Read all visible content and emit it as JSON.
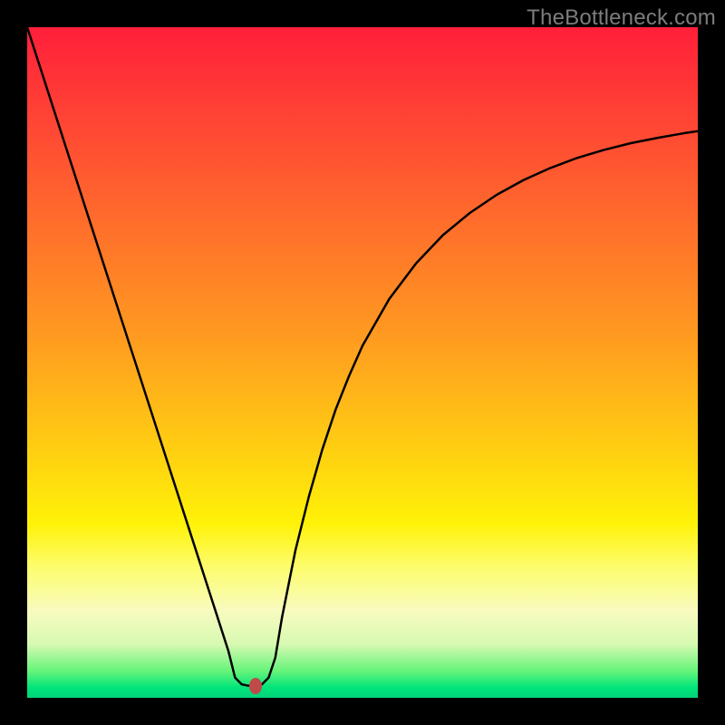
{
  "watermark": "TheBottleneck.com",
  "chart_data": {
    "type": "line",
    "title": "",
    "xlabel": "",
    "ylabel": "",
    "xlim": [
      0,
      100
    ],
    "ylim": [
      0,
      100
    ],
    "grid": false,
    "legend": false,
    "series": [
      {
        "name": "curve",
        "x": [
          0,
          2,
          4,
          6,
          8,
          10,
          12,
          14,
          16,
          18,
          20,
          22,
          24,
          26,
          28,
          30,
          31,
          32,
          33,
          34,
          35,
          36,
          37,
          38,
          40,
          42,
          44,
          46,
          48,
          50,
          54,
          58,
          62,
          66,
          70,
          74,
          78,
          82,
          86,
          90,
          94,
          98,
          100
        ],
        "values": [
          100,
          93.8,
          87.6,
          81.4,
          75.2,
          69.0,
          62.8,
          56.6,
          50.4,
          44.2,
          38.0,
          31.8,
          25.6,
          19.4,
          13.2,
          7.0,
          3.0,
          2.0,
          1.8,
          1.8,
          2.0,
          3.0,
          6.0,
          12.0,
          22.0,
          30.0,
          37.0,
          43.0,
          48.0,
          52.5,
          59.5,
          64.8,
          69.0,
          72.3,
          75.0,
          77.2,
          79.0,
          80.5,
          81.7,
          82.7,
          83.5,
          84.2,
          84.5
        ]
      }
    ],
    "marker": {
      "x": 34.0,
      "y": 1.8,
      "color": "#c0494a"
    }
  }
}
